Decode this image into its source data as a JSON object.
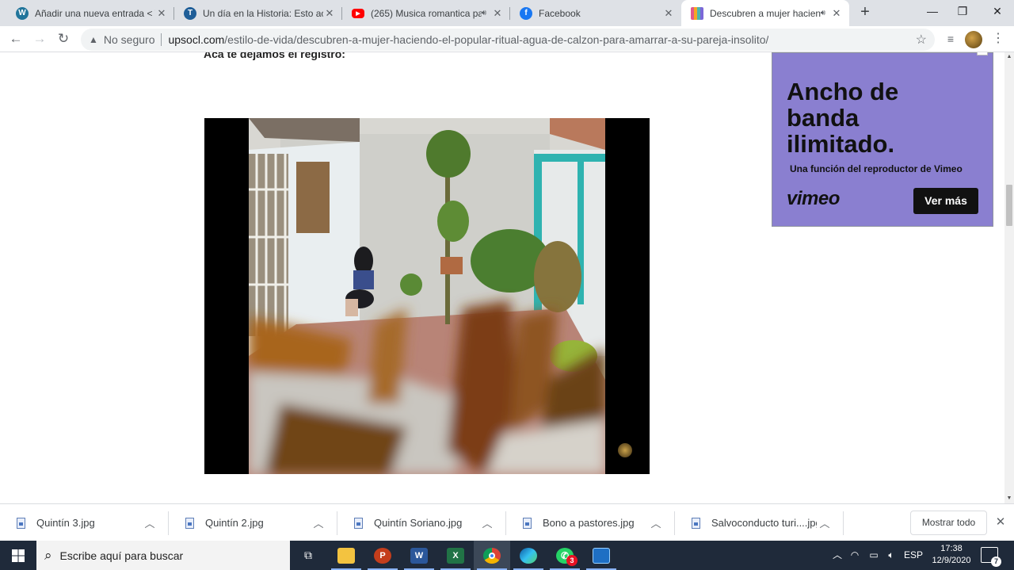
{
  "browser": {
    "tabs": [
      {
        "title": "Añadir una nueva entrada < Ti",
        "favicon": "wordpress-icon",
        "color": "#21759b",
        "glyph": "W"
      },
      {
        "title": "Un día en la Historia: Esto acon",
        "favicon": "site-t-icon",
        "color": "#1f5e98",
        "glyph": "T"
      },
      {
        "title": "(265) Musica romantica pa",
        "favicon": "youtube-icon",
        "color": "#ff0000",
        "glyph": "▶",
        "audio": true
      },
      {
        "title": "Facebook",
        "favicon": "facebook-icon",
        "color": "#1877f2",
        "glyph": "f"
      },
      {
        "title": "Descubren a mujer hacien",
        "favicon": "upsocl-icon",
        "color": "#e0588c",
        "glyph": "",
        "audio": true,
        "active": true
      }
    ],
    "new_tab": "+",
    "security": "No seguro",
    "url_domain": "upsocl.com",
    "url_path": "/estilo-de-vida/descubren-a-mujer-haciendo-el-popular-ritual-agua-de-calzon-para-amarrar-a-su-pareja-insolito/"
  },
  "page": {
    "caption": "Acá te dejamos el registro:"
  },
  "ad": {
    "headline": "Ancho de banda ilimitado.",
    "subline": "Una función del reproductor de Vimeo",
    "logo": "vimeo",
    "cta": "Ver más",
    "background": "#8a7fd0"
  },
  "downloads": {
    "items": [
      "Quintín 3.jpg",
      "Quintín 2.jpg",
      "Quintín Soriano.jpg",
      "Bono a pastores.jpg",
      "Salvoconducto turi....jpg"
    ],
    "show_all": "Mostrar todo"
  },
  "taskbar": {
    "search_placeholder": "Escribe aquí para buscar",
    "language": "ESP",
    "time": "17:38",
    "date": "12/9/2020",
    "whatsapp_badge": "3",
    "notifications": "7",
    "apps": [
      "task-view-icon",
      "file-explorer-icon",
      "powerpoint-icon",
      "word-icon",
      "excel-icon",
      "chrome-icon",
      "edge-icon",
      "whatsapp-icon",
      "photos-icon"
    ]
  }
}
